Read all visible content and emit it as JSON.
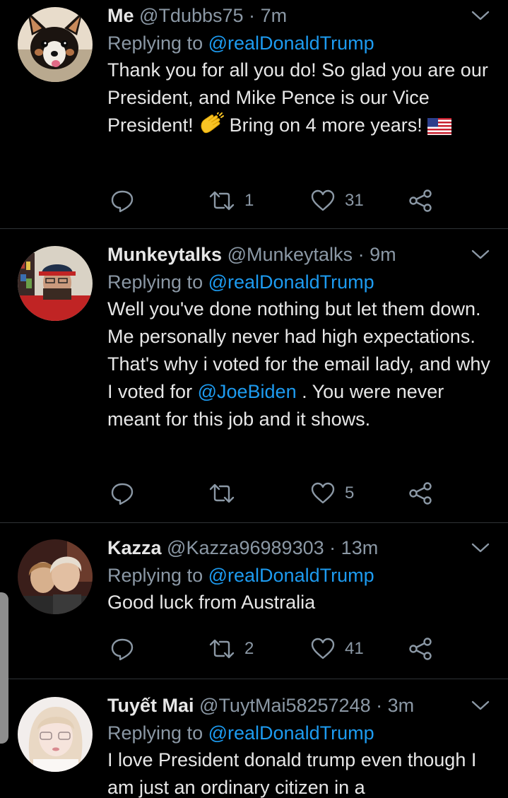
{
  "colors": {
    "background": "#000000",
    "text": "#e7e7e7",
    "muted": "#8b98a5",
    "link": "#1d9bf0",
    "divider": "#2f3336"
  },
  "tweets": [
    {
      "name": "Me",
      "handle": "@Tdubbs75",
      "sep": "·",
      "time": "7m",
      "reply_prefix": "Replying to",
      "reply_to": "@realDonaldTrump",
      "text_1": "Thank you for all you do! So glad you are our President, and Mike Pence is our Vice President!",
      "emoji_1": "clapping-hands",
      "text_2": "Bring on 4 more years!",
      "emoji_2": "us-flag",
      "retweets": "1",
      "likes": "31"
    },
    {
      "name": "Munkeytalks",
      "handle": "@Munkeytalks",
      "sep": "·",
      "time": "9m",
      "reply_prefix": "Replying to",
      "reply_to": "@realDonaldTrump",
      "text_1": "Well you've done nothing but let them down. Me personally never had high expectations. That's why i voted for the email lady, and why I voted for",
      "mention": "@JoeBiden",
      "text_2": ". You were never meant for this job and it shows.",
      "retweets": "",
      "likes": "5"
    },
    {
      "name": "Kazza",
      "handle": "@Kazza96989303",
      "sep": "·",
      "time": "13m",
      "reply_prefix": "Replying to",
      "reply_to": "@realDonaldTrump",
      "text_1": "Good luck from Australia",
      "retweets": "2",
      "likes": "41"
    },
    {
      "name": "Tuyết Mai",
      "handle": "@TuytMai58257248",
      "sep": "·",
      "time": "3m",
      "reply_prefix": "Replying to",
      "reply_to": "@realDonaldTrump",
      "text_1": "I love President donald trump even though I am just an ordinary citizen in a"
    }
  ],
  "icons": {
    "reply": "reply-icon",
    "retweet": "retweet-icon",
    "like": "like-icon",
    "share": "share-icon",
    "more": "chevron-down-icon"
  }
}
